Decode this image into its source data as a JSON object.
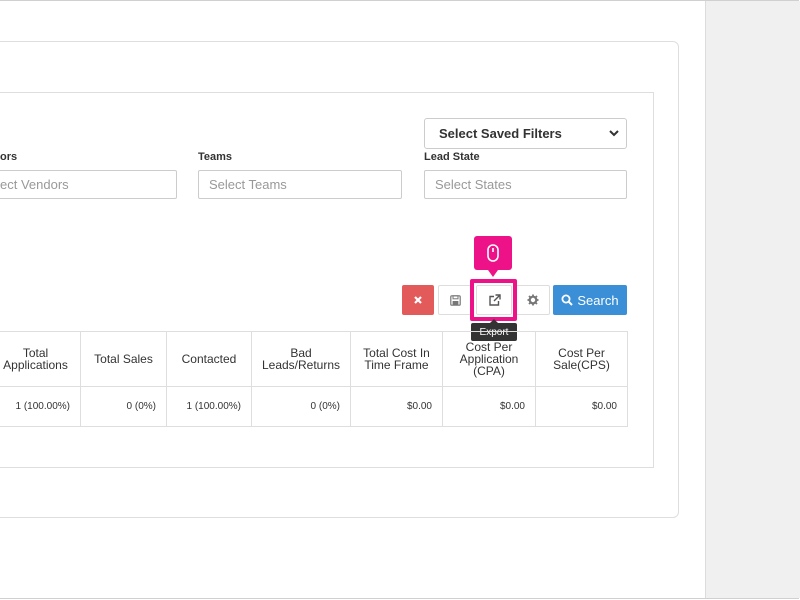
{
  "filters": {
    "saved_filters_label": "Select Saved Filters",
    "vendors": {
      "label": "ors",
      "placeholder": "ect Vendors"
    },
    "teams": {
      "label": "Teams",
      "placeholder": "Select Teams"
    },
    "lead_state": {
      "label": "Lead State",
      "placeholder": "Select States"
    }
  },
  "toolbar": {
    "search_label": "Search",
    "export_tooltip": "Export"
  },
  "table": {
    "headers": [
      "Total Applications",
      "Total Sales",
      "Contacted",
      "Bad Leads/Returns",
      "Total Cost In Time Frame",
      "Cost Per Application (CPA)",
      "Cost Per Sale(CPS)"
    ],
    "rows": [
      [
        "1 (100.00%)",
        "0 (0%)",
        "1 (100.00%)",
        "0 (0%)",
        "$0.00",
        "$0.00",
        "$0.00"
      ]
    ]
  },
  "colors": {
    "highlight": "#ee1289",
    "clear_button": "#e35a5a",
    "search_button": "#3a8fd6"
  },
  "icons": {
    "clear": "close-icon",
    "save": "floppy-disk-icon",
    "export": "external-link-icon",
    "settings": "gear-icon",
    "search": "search-icon",
    "click_indicator": "mouse-icon"
  }
}
